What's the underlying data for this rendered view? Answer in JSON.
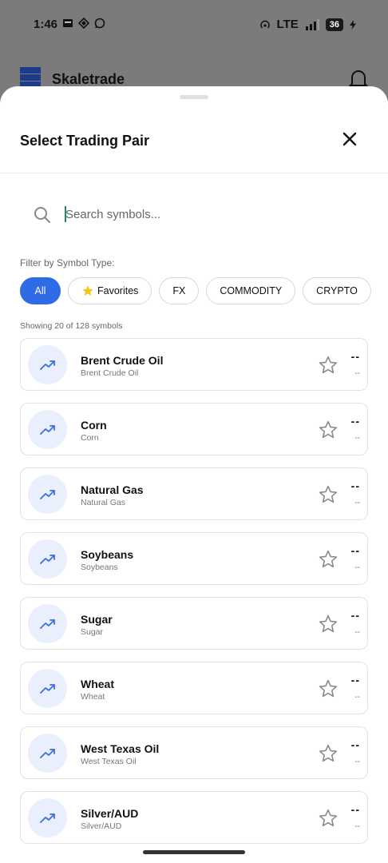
{
  "status": {
    "time": "1:46",
    "network": "LTE",
    "battery": "36"
  },
  "app": {
    "name": "Skaletrade"
  },
  "sheet": {
    "title": "Select Trading Pair",
    "search_placeholder": "Search symbols...",
    "filter_label": "Filter by Symbol Type:",
    "filters": [
      "All",
      "Favorites",
      "FX",
      "COMMODITY",
      "CRYPTO"
    ],
    "active_filter": "All",
    "showing": "Showing 20 of 128 symbols"
  },
  "colors": {
    "accent": "#2f6be6",
    "avatar_bg": "#e9effd",
    "favorite_star": "#f5c518"
  },
  "symbols": [
    {
      "name": "Brent Crude Oil",
      "sub": "Brent Crude Oil",
      "price": "--",
      "change": "--"
    },
    {
      "name": "Corn",
      "sub": "Corn",
      "price": "--",
      "change": "--"
    },
    {
      "name": "Natural Gas",
      "sub": "Natural Gas",
      "price": "--",
      "change": "--"
    },
    {
      "name": "Soybeans",
      "sub": "Soybeans",
      "price": "--",
      "change": "--"
    },
    {
      "name": "Sugar",
      "sub": "Sugar",
      "price": "--",
      "change": "--"
    },
    {
      "name": "Wheat",
      "sub": "Wheat",
      "price": "--",
      "change": "--"
    },
    {
      "name": "West Texas Oil",
      "sub": "West Texas Oil",
      "price": "--",
      "change": "--"
    },
    {
      "name": "Silver/AUD",
      "sub": "Silver/AUD",
      "price": "--",
      "change": "--"
    }
  ]
}
